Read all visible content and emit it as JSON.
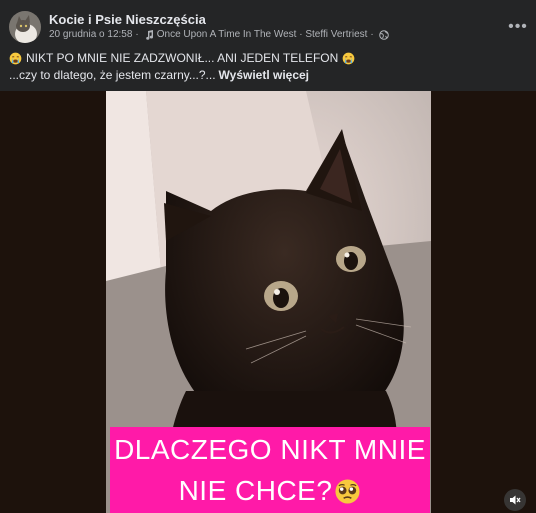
{
  "post": {
    "page_name": "Kocie i Psie Nieszczęścia",
    "timestamp": "20 grudnia o 12:58",
    "separator": "·",
    "music_icon": "music-note-icon",
    "music_track": "Once Upon A Time In The West · Steffi Vertriest",
    "audience_icon": "globe-icon",
    "more_icon": "more-options-icon",
    "more_label": "•••",
    "caption_line1": "NIKT PO MNIE NIE ZADZWONIŁ... ANI JEDEN TELEFON",
    "caption_emoji": "crying-face-icon",
    "caption_line2": "...czy to dlatego, że jestem czarny...?...",
    "see_more": "Wyświetl więcej"
  },
  "media": {
    "overlay_line1": "DLACZEGO NIKT MNIE",
    "overlay_line2": "NIE CHCE?",
    "overlay_emoji": "pleading-face-icon",
    "banner_color": "#ff1aa8",
    "mute_icon": "speaker-muted-icon"
  }
}
